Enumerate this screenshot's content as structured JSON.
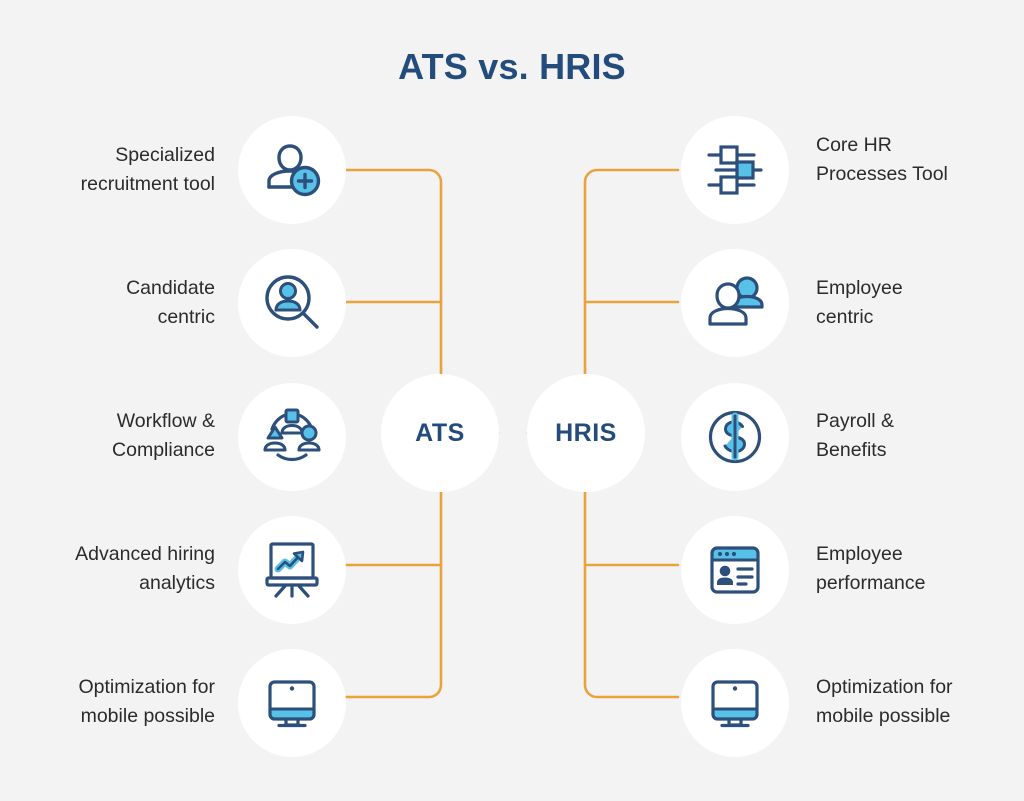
{
  "page": {
    "title": "ATS vs. HRIS",
    "background_color": "#f2f3f2",
    "accent_color": "#e8a33d",
    "navy_color": "#234b7c",
    "light_blue_color": "#57c1e8",
    "bubble_color": "#ffffff",
    "text_color": "#2b2b2b"
  },
  "hubs": {
    "left": {
      "label": "ATS"
    },
    "right": {
      "label": "HRIS"
    }
  },
  "left_branch": {
    "items": [
      {
        "label": "Specialized\nrecruitment tool",
        "icon": "user-add-icon"
      },
      {
        "label": "Candidate\ncentric",
        "icon": "candidate-search-icon"
      },
      {
        "label": "Workflow &\nCompliance",
        "icon": "workflow-group-icon"
      },
      {
        "label": "Advanced hiring\nanalytics",
        "icon": "analytics-chart-icon"
      },
      {
        "label": "Optimization for\nmobile possible",
        "icon": "desktop-monitor-icon"
      }
    ]
  },
  "right_branch": {
    "items": [
      {
        "label": "Core HR\nProcesses Tool",
        "icon": "sliders-settings-icon"
      },
      {
        "label": "Employee\ncentric",
        "icon": "two-people-icon"
      },
      {
        "label": "Payroll &\nBenefits",
        "icon": "dollar-coin-icon"
      },
      {
        "label": "Employee\nperformance",
        "icon": "profile-window-icon"
      },
      {
        "label": "Optimization for\nmobile possible",
        "icon": "desktop-monitor-icon"
      }
    ]
  }
}
